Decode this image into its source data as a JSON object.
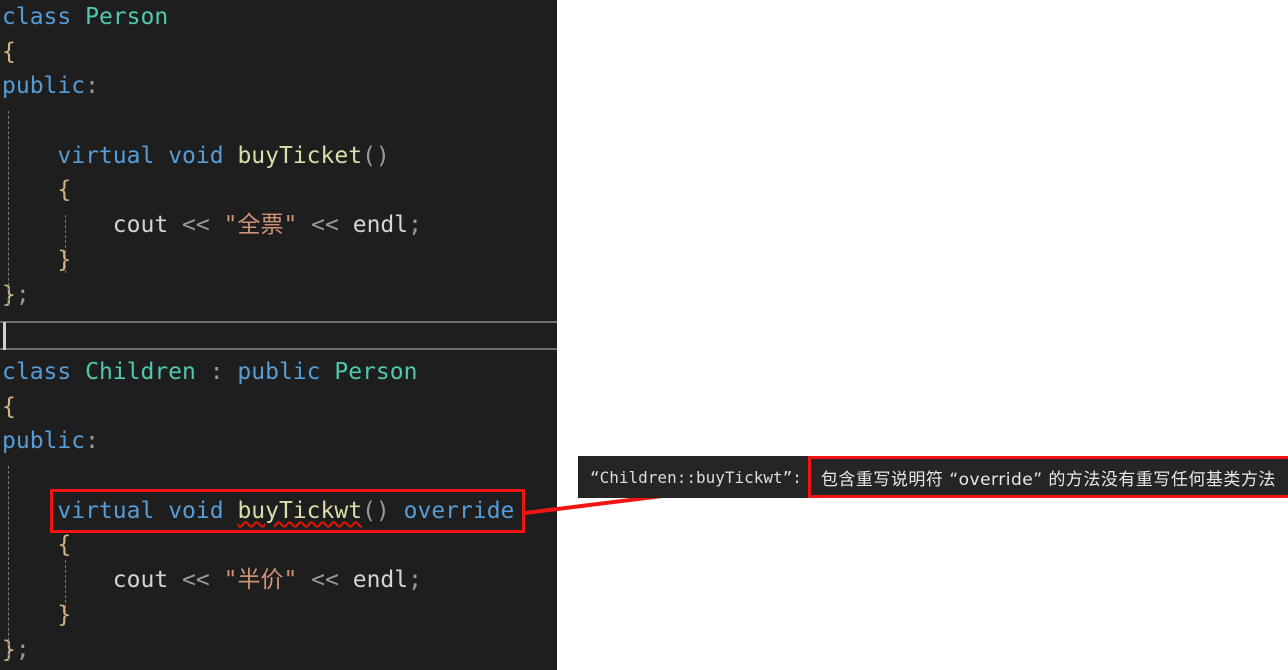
{
  "editor": {
    "background_color": "#1e1e1e",
    "language": "cpp",
    "person_class": {
      "lines": [
        {
          "tokens": [
            {
              "t": "class ",
              "c": "kw"
            },
            {
              "t": "Person",
              "c": "type"
            }
          ]
        },
        {
          "tokens": [
            {
              "t": "{",
              "c": "br"
            }
          ]
        },
        {
          "tokens": [
            {
              "t": "public",
              "c": "kw"
            },
            {
              "t": ":",
              "c": "op"
            }
          ]
        },
        {
          "tokens": []
        },
        {
          "tokens": [
            {
              "t": "    ",
              "c": "pl"
            },
            {
              "t": "virtual",
              "c": "kw"
            },
            {
              "t": " ",
              "c": "pl"
            },
            {
              "t": "void",
              "c": "kw"
            },
            {
              "t": " ",
              "c": "pl"
            },
            {
              "t": "buyTicket",
              "c": "fn"
            },
            {
              "t": "()",
              "c": "op"
            }
          ]
        },
        {
          "tokens": [
            {
              "t": "    ",
              "c": "pl"
            },
            {
              "t": "{",
              "c": "br"
            }
          ]
        },
        {
          "tokens": [
            {
              "t": "        ",
              "c": "pl"
            },
            {
              "t": "cout",
              "c": "pl"
            },
            {
              "t": " ",
              "c": "pl"
            },
            {
              "t": "<<",
              "c": "op"
            },
            {
              "t": " ",
              "c": "pl"
            },
            {
              "t": "\"全票\"",
              "c": "str"
            },
            {
              "t": " ",
              "c": "pl"
            },
            {
              "t": "<<",
              "c": "op"
            },
            {
              "t": " ",
              "c": "pl"
            },
            {
              "t": "endl",
              "c": "pl"
            },
            {
              "t": ";",
              "c": "op"
            }
          ]
        },
        {
          "tokens": [
            {
              "t": "    ",
              "c": "pl"
            },
            {
              "t": "}",
              "c": "br"
            }
          ]
        },
        {
          "tokens": [
            {
              "t": "}",
              "c": "br"
            },
            {
              "t": ";",
              "c": "op"
            }
          ]
        }
      ]
    },
    "children_class": {
      "lines": [
        {
          "tokens": [
            {
              "t": "class ",
              "c": "kw"
            },
            {
              "t": "Children",
              "c": "type"
            },
            {
              "t": " : ",
              "c": "op"
            },
            {
              "t": "public",
              "c": "kw"
            },
            {
              "t": " ",
              "c": "pl"
            },
            {
              "t": "Person",
              "c": "type"
            }
          ]
        },
        {
          "tokens": [
            {
              "t": "{",
              "c": "br"
            }
          ]
        },
        {
          "tokens": [
            {
              "t": "public",
              "c": "kw"
            },
            {
              "t": ":",
              "c": "op"
            }
          ]
        },
        {
          "tokens": []
        },
        {
          "tokens": [
            {
              "t": "    ",
              "c": "pl"
            },
            {
              "t": "virtual",
              "c": "kw"
            },
            {
              "t": " ",
              "c": "pl"
            },
            {
              "t": "void",
              "c": "kw"
            },
            {
              "t": " ",
              "c": "pl"
            },
            {
              "t": "buyTickwt",
              "c": "fn",
              "error": true
            },
            {
              "t": "()",
              "c": "op"
            },
            {
              "t": " ",
              "c": "pl"
            },
            {
              "t": "override",
              "c": "kw"
            }
          ]
        },
        {
          "tokens": [
            {
              "t": "    ",
              "c": "pl"
            },
            {
              "t": "{",
              "c": "br"
            }
          ]
        },
        {
          "tokens": [
            {
              "t": "        ",
              "c": "pl"
            },
            {
              "t": "cout",
              "c": "pl"
            },
            {
              "t": " ",
              "c": "pl"
            },
            {
              "t": "<<",
              "c": "op"
            },
            {
              "t": " ",
              "c": "pl"
            },
            {
              "t": "\"半价\"",
              "c": "str"
            },
            {
              "t": " ",
              "c": "pl"
            },
            {
              "t": "<<",
              "c": "op"
            },
            {
              "t": " ",
              "c": "pl"
            },
            {
              "t": "endl",
              "c": "pl"
            },
            {
              "t": ";",
              "c": "op"
            }
          ]
        },
        {
          "tokens": [
            {
              "t": "    ",
              "c": "pl"
            },
            {
              "t": "}",
              "c": "br"
            }
          ]
        },
        {
          "tokens": [
            {
              "t": "}",
              "c": "br"
            },
            {
              "t": ";",
              "c": "op"
            }
          ]
        }
      ]
    }
  },
  "annotation": {
    "highlight_color": "#f01414",
    "arrow_color": "#f01414"
  },
  "tooltip": {
    "symbol": "“Children::buyTickwt”:",
    "message": "包含重写说明符 “override” 的方法没有重写任何基类方法",
    "background_color": "#252526",
    "border_color": "#f01414"
  },
  "syntax_colors": {
    "keyword": "#569cd6",
    "type": "#4ec9b0",
    "function": "#dcdcaa",
    "string": "#ce9178",
    "brace": "#d4b483",
    "operator": "#9a9a9a",
    "plain": "#d4d4d4",
    "error_squiggle": "#e51400"
  }
}
